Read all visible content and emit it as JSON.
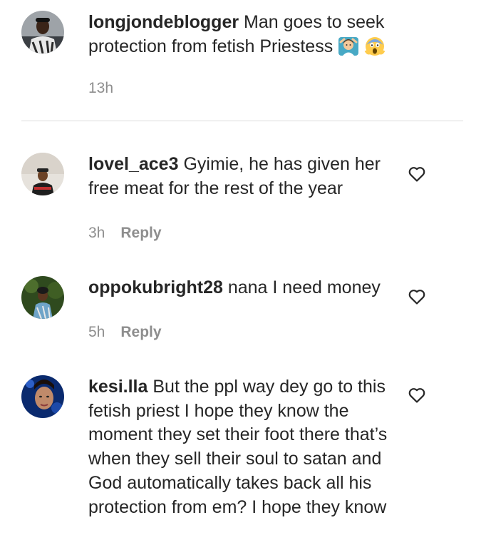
{
  "caption": {
    "username": "longjondeblogger",
    "text": "Man goes to seek protection from fetish Priestess",
    "emojis": [
      "man-gesturing-ok-emoji",
      "screaming-face-emoji"
    ],
    "time": "13h"
  },
  "comments": [
    {
      "username": "lovel_ace3",
      "text": "Gyimie, he has given her free meat for the rest of the year",
      "time": "3h",
      "reply_label": "Reply"
    },
    {
      "username": "oppokubright28",
      "text": "nana I need money",
      "time": "5h",
      "reply_label": "Reply"
    },
    {
      "username": "kesi.lla",
      "text": "But the ppl way dey go to this fetish priest I hope they know the moment they set their foot there that’s when they sell their soul to satan and God automatically takes back all his protection from em? I hope they know"
    }
  ],
  "icons": {
    "like": "heart-outline-icon"
  },
  "colors": {
    "text": "#262626",
    "muted": "#8e8e8e",
    "divider": "#dbdbdb"
  }
}
